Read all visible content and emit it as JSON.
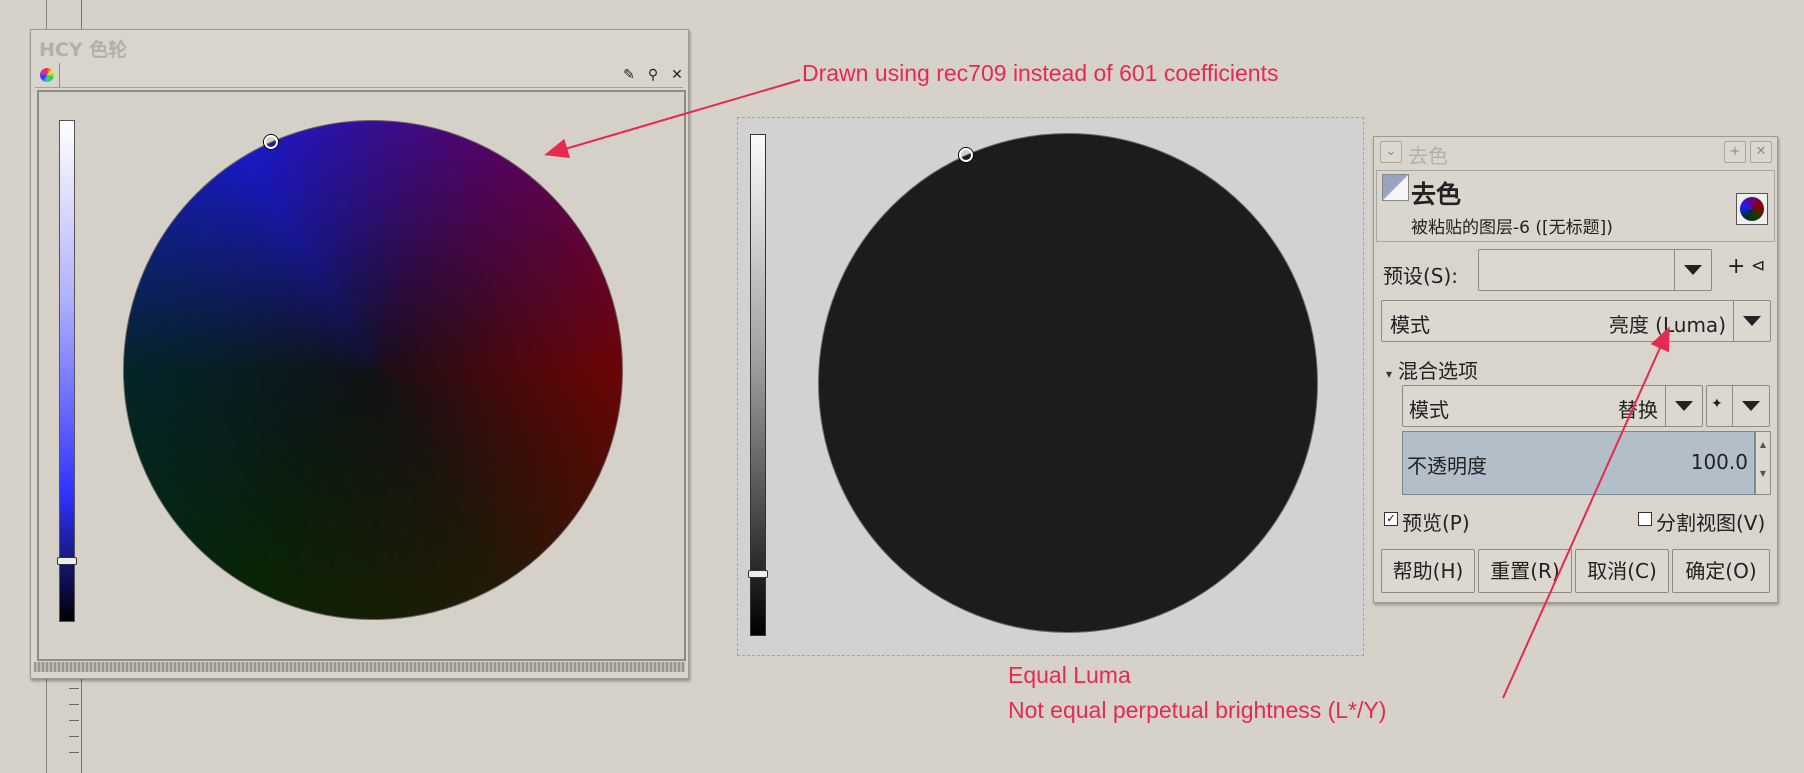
{
  "hcy_window": {
    "title": "HCY 色轮",
    "tab_icon": "color-wheel-icon",
    "toolbar_icons": [
      "wrench-icon",
      "pick-icon",
      "close-icon"
    ]
  },
  "desaturate_dialog": {
    "title": "去色",
    "header_title": "去色",
    "header_subtitle": "被粘贴的图层-6 ([无标题])",
    "preset_label": "预设(S):",
    "preset_value": "",
    "mode_label": "模式",
    "mode_value": "亮度 (Luma)",
    "blend_options_label": "混合选项",
    "blend_mode_label": "模式",
    "blend_mode_value": "替换",
    "opacity_label": "不透明度",
    "opacity_value": "100.0",
    "preview_label": "预览(P)",
    "preview_checked": true,
    "split_view_label": "分割视图(V)",
    "split_view_checked": false,
    "buttons": {
      "help": "帮助(H)",
      "reset": "重置(R)",
      "cancel": "取消(C)",
      "ok": "确定(O)"
    }
  },
  "annotations": {
    "top": "Drawn using rec709 instead of 601 coefficients",
    "bottom_line1": "Equal Luma",
    "bottom_line2": "Not equal perpetual brightness (L*/Y)",
    "color": "#e8294e"
  }
}
